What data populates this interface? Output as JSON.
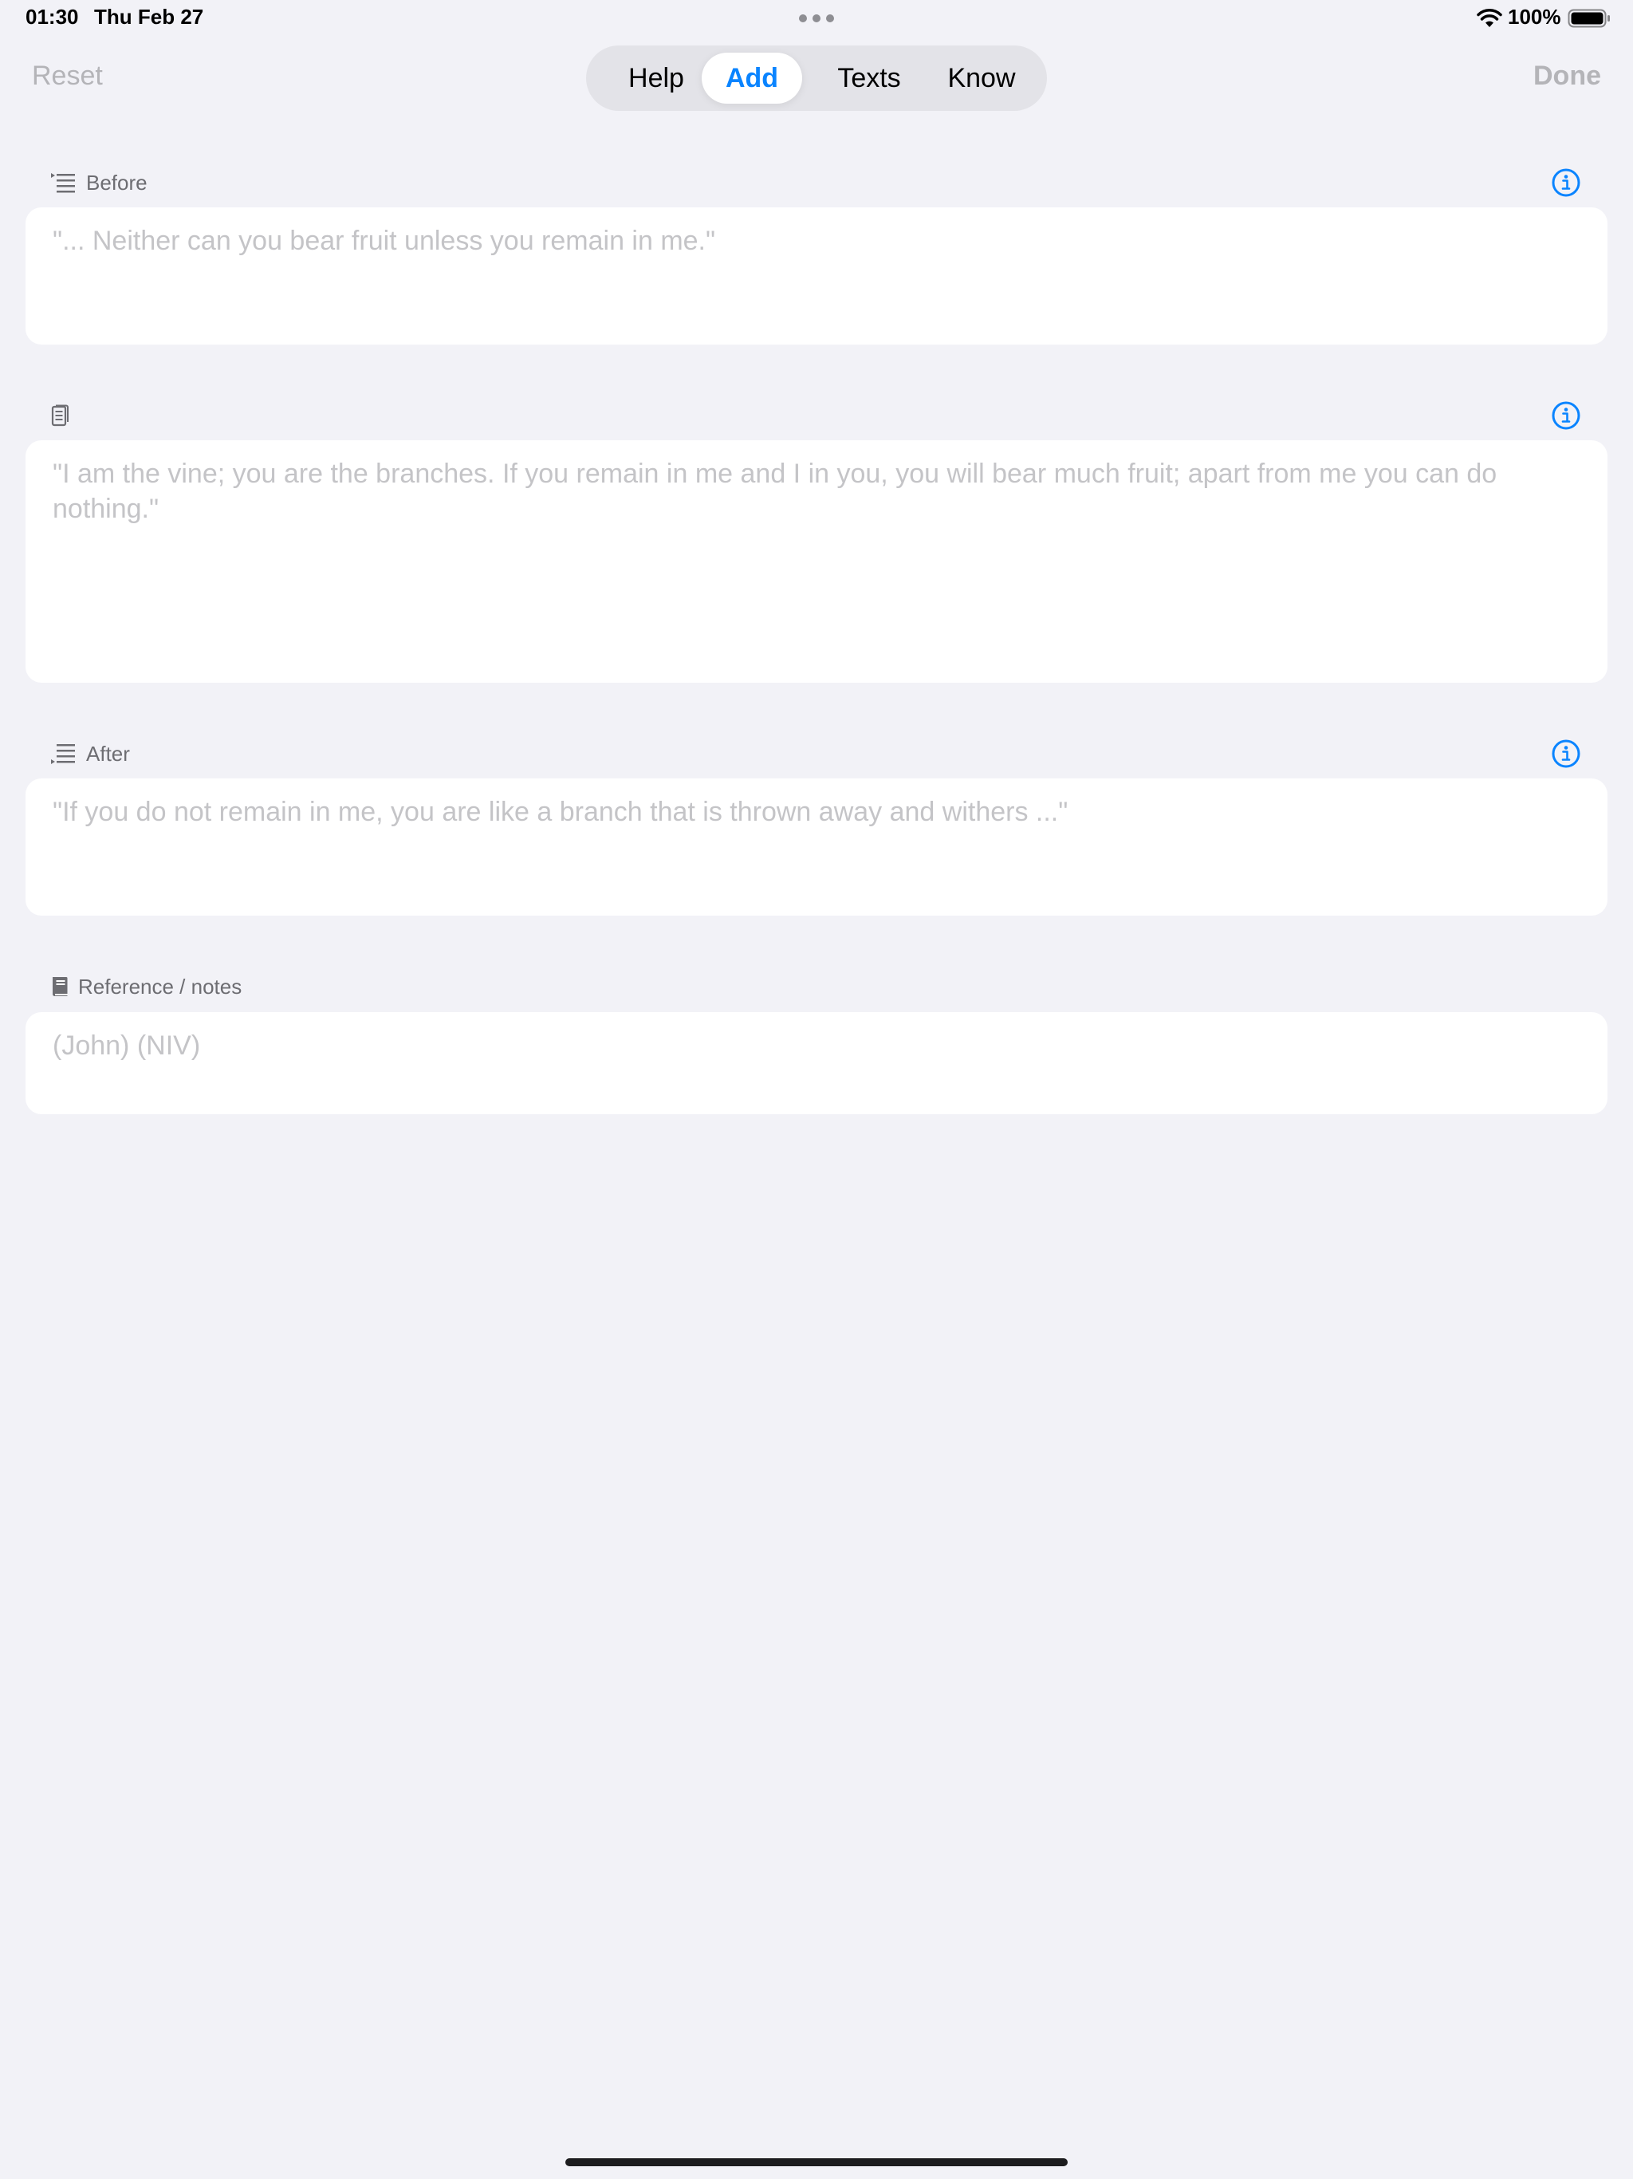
{
  "status_bar": {
    "time": "01:30",
    "date": "Thu Feb 27",
    "battery": "100%"
  },
  "nav": {
    "reset_label": "Reset",
    "done_label": "Done",
    "tabs": [
      {
        "label": "Help",
        "selected": false
      },
      {
        "label": "Add",
        "selected": true
      },
      {
        "label": "Texts",
        "selected": false
      },
      {
        "label": "Know",
        "selected": false
      }
    ]
  },
  "sections": {
    "before": {
      "label": "Before",
      "placeholder": "\"... Neither can you bear fruit unless you remain in me.\""
    },
    "main": {
      "label": "",
      "placeholder": "\"I am the vine; you are the branches. If you remain in me and I in you, you will bear much fruit; apart from me you can do nothing.\""
    },
    "after": {
      "label": "After",
      "placeholder": "\"If you do not remain in me, you are like a branch that is thrown away and withers ...\""
    },
    "reference": {
      "label": "Reference / notes",
      "placeholder": "(John) (NIV)"
    }
  },
  "colors": {
    "accent": "#0a84ff",
    "background": "#f2f2f7",
    "placeholder": "#c4c4c7",
    "secondary_label": "#6d6d72"
  },
  "icons": {
    "before": "text-indent-before-icon",
    "main": "document-icon",
    "after": "text-indent-after-icon",
    "reference": "book-icon",
    "info": "info-circle-icon"
  }
}
